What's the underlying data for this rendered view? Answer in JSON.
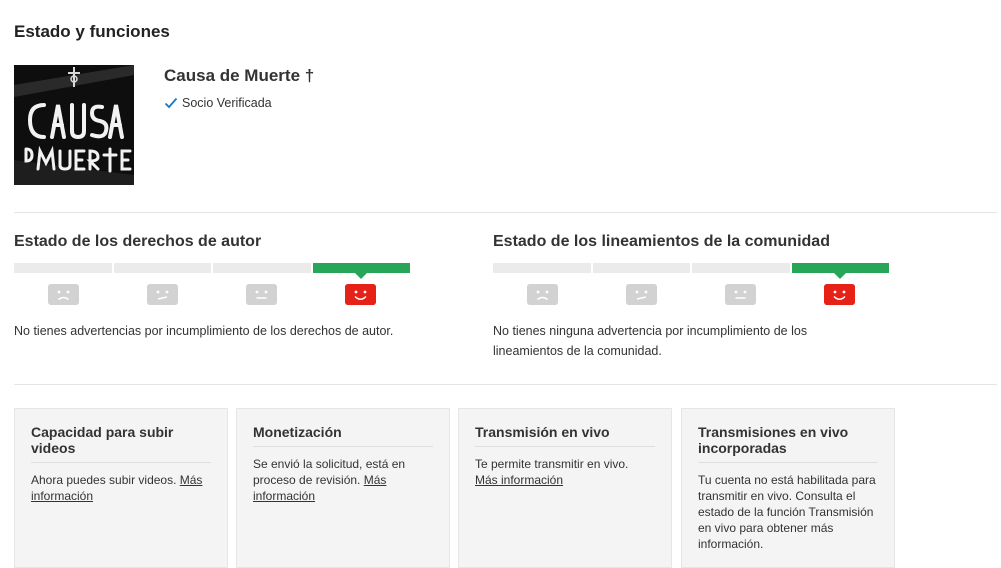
{
  "page": {
    "title": "Estado y funciones"
  },
  "channel": {
    "name": "Causa de Muerte †",
    "verified_label": "Socio Verificada",
    "avatar_icon": "causa-de-muerte-logo"
  },
  "colors": {
    "accent_green": "#27a657",
    "strike_red": "#e62117",
    "segment_gray": "#ebebeb",
    "face_gray": "#d2d2d2",
    "check_blue": "#167ac6"
  },
  "copyright": {
    "title": "Estado de los derechos de autor",
    "active_segment": 4,
    "segments": 4,
    "message": "No tienes advertencias por incumplimiento de los derechos de autor."
  },
  "community": {
    "title": "Estado de los lineamientos de la comunidad",
    "active_segment": 4,
    "segments": 4,
    "message": "No tienes ninguna advertencia por incumplimiento de los lineamientos de la comunidad."
  },
  "features": [
    {
      "title": "Capacidad para subir videos",
      "text": "Ahora puedes subir videos. ",
      "link": "Más información"
    },
    {
      "title": "Monetización",
      "text": "Se envió la solicitud, está en proceso de revisión. ",
      "link": "Más información"
    },
    {
      "title": "Transmisión en vivo",
      "text": "Te permite transmitir en vivo. ",
      "link": "Más información"
    },
    {
      "title": "Transmisiones en vivo incorporadas",
      "text": "Tu cuenta no está habilitada para transmitir en vivo. Consulta el estado de la función Transmisión en vivo para obtener más información.",
      "link": ""
    }
  ]
}
